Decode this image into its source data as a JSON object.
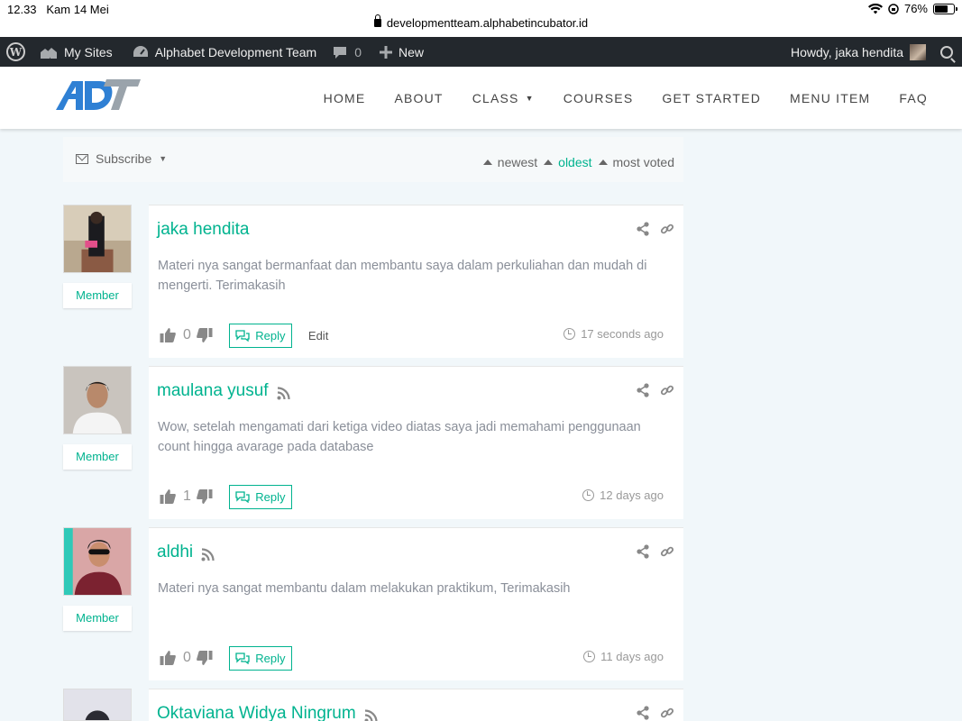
{
  "status_bar": {
    "time": "12.33",
    "date": "Kam 14 Mei",
    "battery": "76%",
    "battery_level": 0.76,
    "url": "developmentteam.alphabetincubator.id"
  },
  "admin_bar": {
    "my_sites": "My Sites",
    "site_name": "Alphabet Development Team",
    "comments_count": "0",
    "new_label": "New",
    "howdy": "Howdy, jaka hendita"
  },
  "header": {
    "nav": [
      "HOME",
      "ABOUT",
      "CLASS",
      "COURSES",
      "GET STARTED",
      "MENU ITEM",
      "FAQ"
    ],
    "colors": {
      "accent": "#00b38f",
      "logo_blue": "#2f80d4",
      "logo_gray": "#9aa3ab"
    }
  },
  "comments_header": {
    "subscribe": "Subscribe",
    "sort_newest": "newest",
    "sort_oldest": "oldest",
    "sort_most_voted": "most voted"
  },
  "comments": [
    {
      "author": "jaka hendita",
      "role": "Member",
      "text": "Materi nya sangat bermanfaat dan membantu saya dalam perkuliahan dan mudah di mengerti. Terimakasih",
      "votes": "0",
      "reply": "Reply",
      "edit": "Edit",
      "time": "17 seconds ago"
    },
    {
      "author": "maulana yusuf",
      "role": "Member",
      "text": "Wow, setelah mengamati dari ketiga video diatas saya jadi memahami penggunaan count hingga avarage pada database",
      "votes": "1",
      "reply": "Reply",
      "time": "12 days ago"
    },
    {
      "author": "aldhi",
      "role": "Member",
      "text": "Materi nya sangat membantu dalam melakukan praktikum, Terimakasih",
      "votes": "0",
      "reply": "Reply",
      "time": "11 days ago"
    },
    {
      "author": "Oktaviana Widya Ningrum"
    }
  ]
}
